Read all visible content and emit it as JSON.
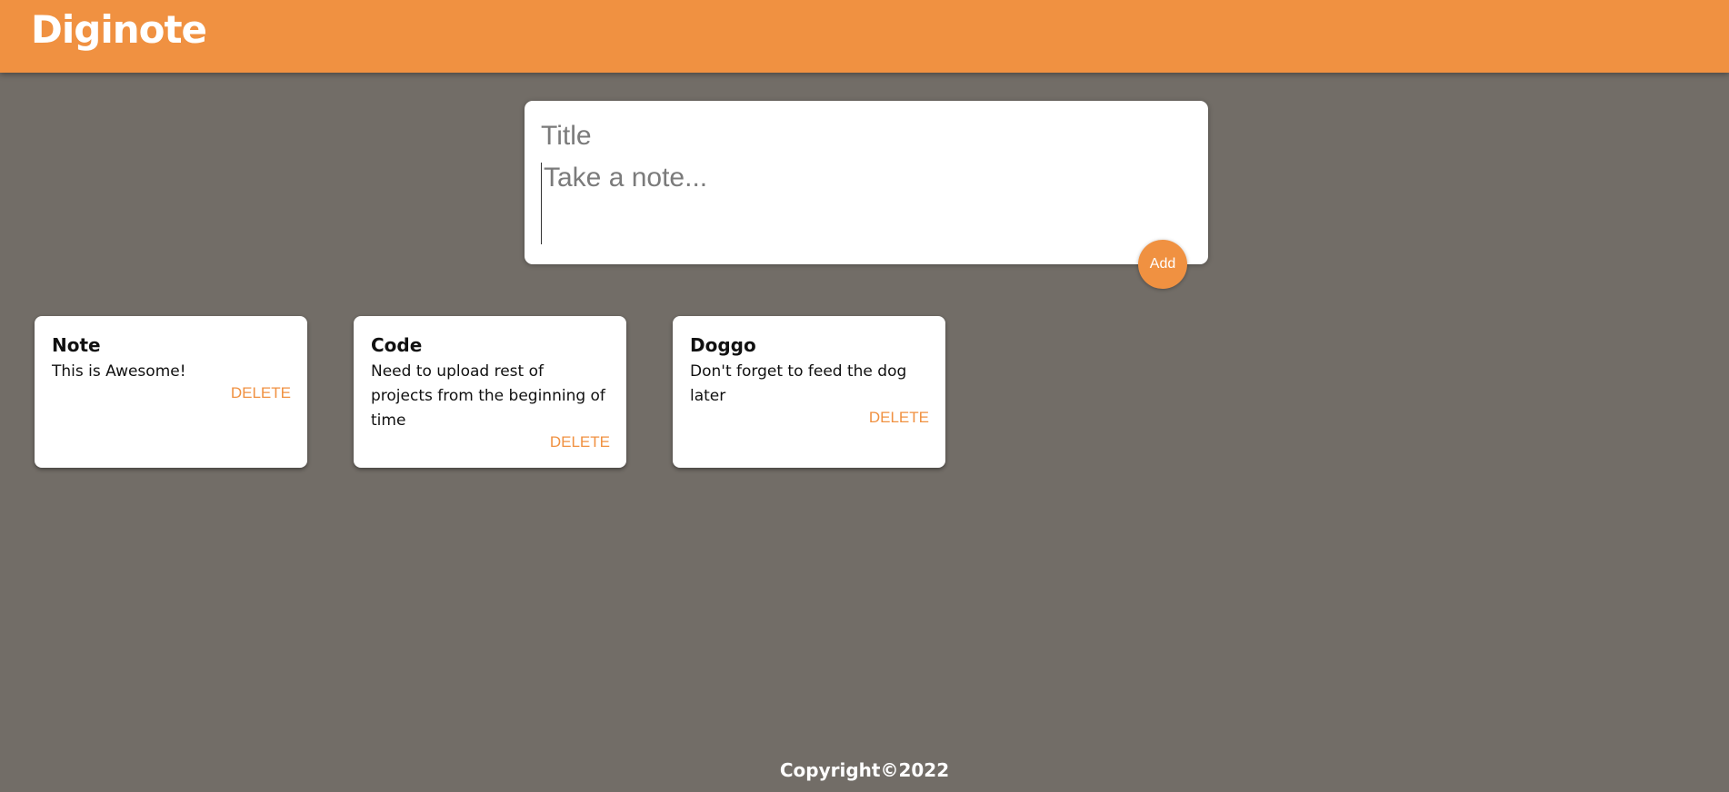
{
  "header": {
    "app_name": "Diginote"
  },
  "create_note": {
    "title_placeholder": "Title",
    "title_value": "",
    "content_placeholder": "Take a note...",
    "content_value": "",
    "add_label": "Add"
  },
  "notes": [
    {
      "title": "Note",
      "content": "This is Awesome!",
      "delete_label": "DELETE"
    },
    {
      "title": "Code",
      "content": "Need to upload rest of projects from the beginning of time",
      "delete_label": "DELETE"
    },
    {
      "title": "Doggo",
      "content": "Don't forget to feed the dog later",
      "delete_label": "DELETE"
    }
  ],
  "footer": {
    "copyright": "Copyright©2022"
  },
  "colors": {
    "accent": "#f09141",
    "background": "#726d67",
    "card": "#ffffff"
  }
}
